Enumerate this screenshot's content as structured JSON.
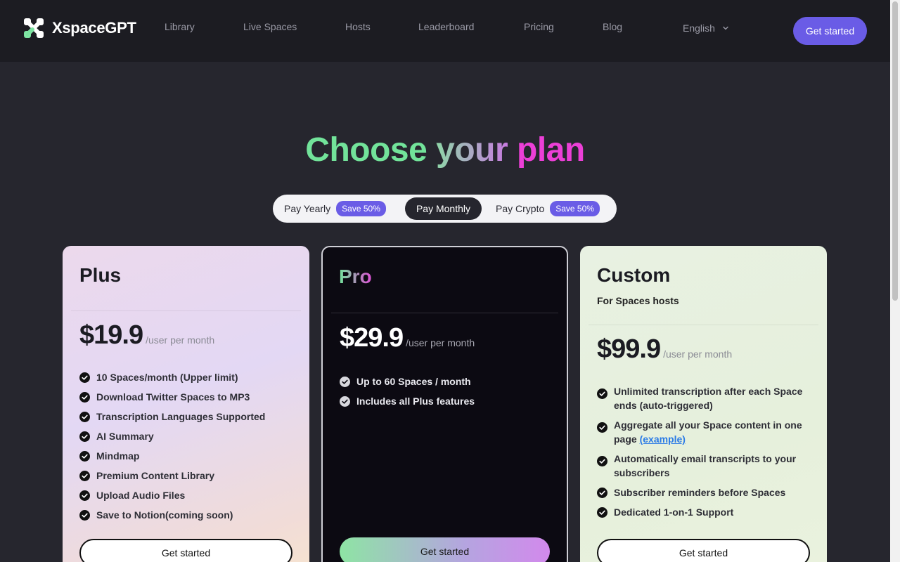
{
  "header": {
    "brand": "XspaceGPT",
    "nav": [
      "Library",
      "Live Spaces",
      "Hosts",
      "Leaderboard",
      "Pricing",
      "Blog"
    ],
    "language": "English",
    "cta": "Get started"
  },
  "hero": {
    "title_part1": "Choose",
    "title_part2": "your",
    "title_part3": "plan"
  },
  "billing_toggle": {
    "yearly": "Pay Yearly",
    "yearly_badge": "Save 50%",
    "monthly": "Pay Monthly",
    "crypto": "Pay Crypto",
    "crypto_badge": "Save 50%",
    "selected": "Pay Monthly"
  },
  "plans": [
    {
      "name": "Plus",
      "price": "$19.9",
      "period": "/user per month",
      "features": [
        "10 Spaces/month (Upper limit)",
        "Download Twitter Spaces to MP3",
        "Transcription Languages Supported",
        "AI Summary",
        "Mindmap",
        "Premium Content Library",
        "Upload Audio Files",
        "Save to Notion(coming soon)"
      ],
      "cta": "Get started"
    },
    {
      "name": "Pro",
      "price": "$29.9",
      "period": "/user per month",
      "features": [
        "Up to 60 Spaces / month",
        "Includes all Plus features"
      ],
      "cta": "Get started"
    },
    {
      "name": "Custom",
      "subtitle": "For Spaces hosts",
      "price": "$99.9",
      "period": "/user per month",
      "features": [
        "Unlimited transcription after each Space ends (auto-triggered)",
        "Aggregate all your Space content in one page",
        "Automatically email transcripts to your subscribers",
        "Subscriber reminders before Spaces",
        "Dedicated 1-on-1 Support"
      ],
      "feature_link": "(example)",
      "cta": "Get started"
    }
  ],
  "colors": {
    "accent": "#6a5ce6",
    "page_bg": "#26262e",
    "header_bg": "#1c1c22",
    "gradient_green": "#72e39a",
    "gradient_pink": "#ec3fd7"
  }
}
